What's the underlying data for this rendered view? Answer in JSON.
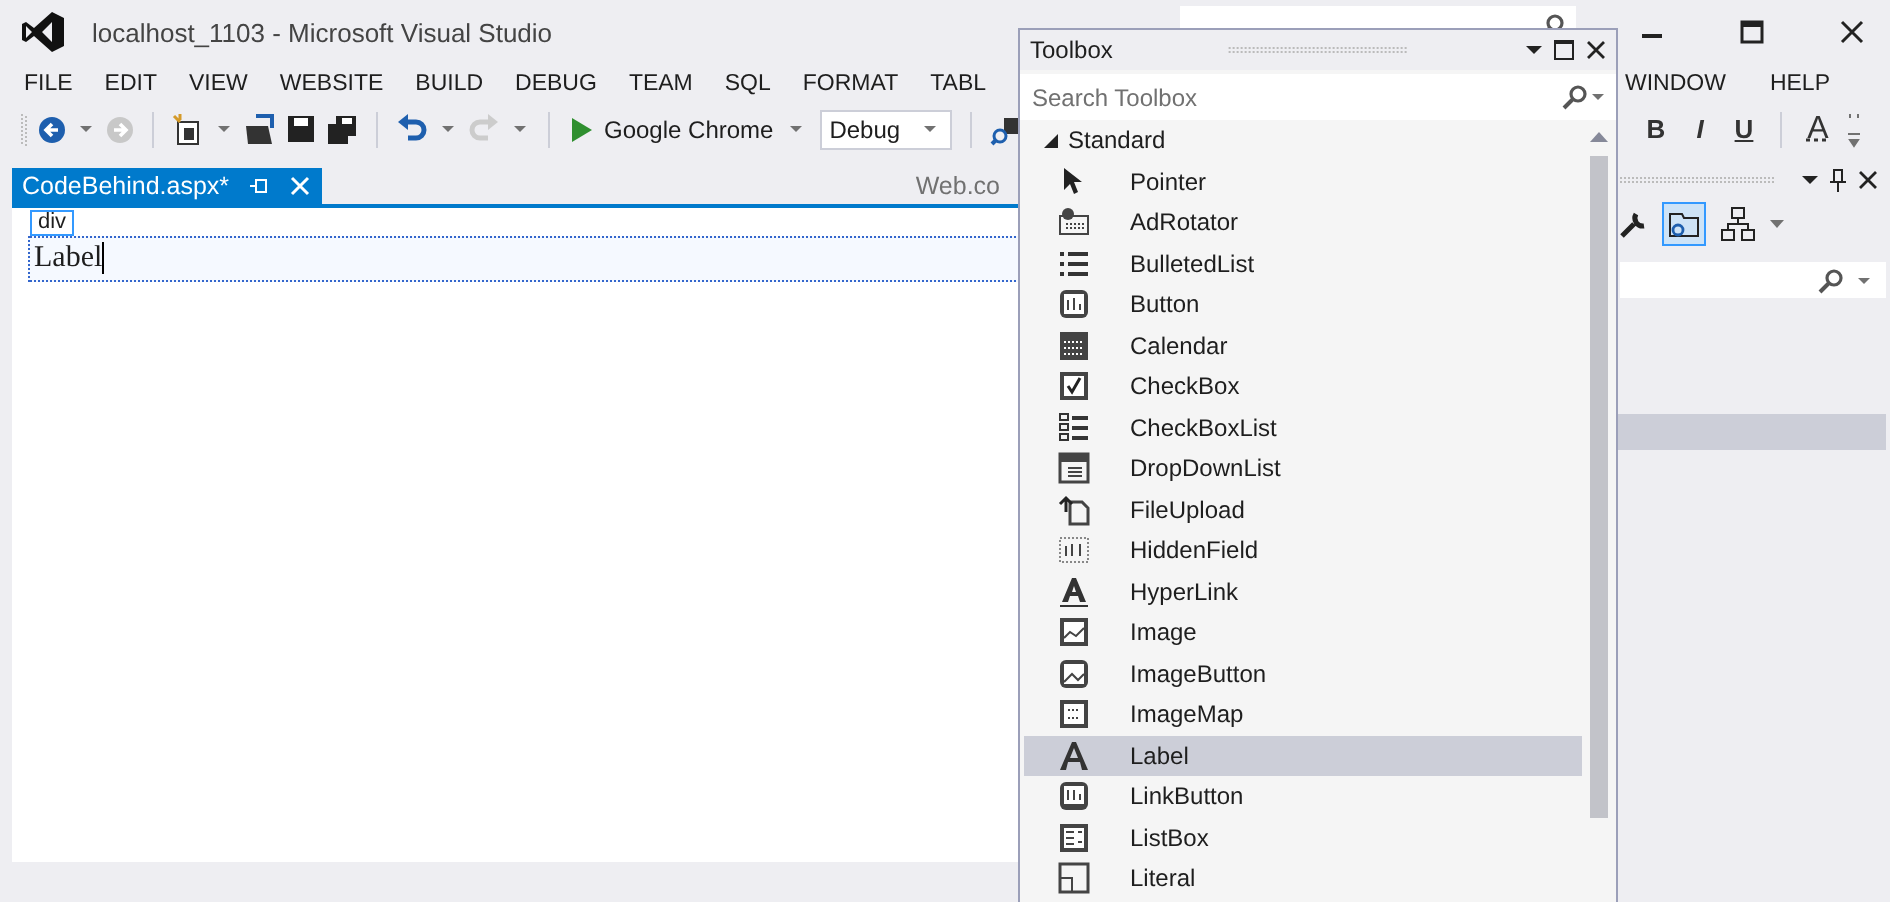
{
  "window": {
    "title": "localhost_1103 - Microsoft Visual Studio"
  },
  "menu": [
    "FILE",
    "EDIT",
    "VIEW",
    "WEBSITE",
    "BUILD",
    "DEBUG",
    "TEAM",
    "SQL",
    "FORMAT",
    "TABL"
  ],
  "menu_right": [
    "WINDOW",
    "HELP"
  ],
  "toolbar": {
    "run_target": "Google Chrome",
    "configuration": "Debug"
  },
  "format_buttons": [
    "B",
    "I",
    "U",
    "A"
  ],
  "document_tabs": [
    {
      "label": "CodeBehind.aspx*",
      "selected": true
    },
    {
      "label": "Web.co",
      "selected": false
    }
  ],
  "designer": {
    "tag": "div",
    "label": "Label"
  },
  "toolbox": {
    "title": "Toolbox",
    "search": {
      "placeholder": "Search Toolbox"
    },
    "groups": [
      {
        "label": "Standard",
        "expanded": true,
        "children": [
          {
            "label": "Pointer",
            "selected": false
          },
          {
            "label": "AdRotator",
            "selected": false
          },
          {
            "label": "BulletedList",
            "selected": false
          },
          {
            "label": "Button",
            "selected": false
          },
          {
            "label": "Calendar",
            "selected": false
          },
          {
            "label": "CheckBox",
            "selected": false
          },
          {
            "label": "CheckBoxList",
            "selected": false
          },
          {
            "label": "DropDownList",
            "selected": false
          },
          {
            "label": "FileUpload",
            "selected": false
          },
          {
            "label": "HiddenField",
            "selected": false
          },
          {
            "label": "HyperLink",
            "selected": false
          },
          {
            "label": "Image",
            "selected": false
          },
          {
            "label": "ImageButton",
            "selected": false
          },
          {
            "label": "ImageMap",
            "selected": false
          },
          {
            "label": "Label",
            "selected": true
          },
          {
            "label": "LinkButton",
            "selected": false
          },
          {
            "label": "ListBox",
            "selected": false
          },
          {
            "label": "Literal",
            "selected": false
          }
        ]
      }
    ]
  }
}
